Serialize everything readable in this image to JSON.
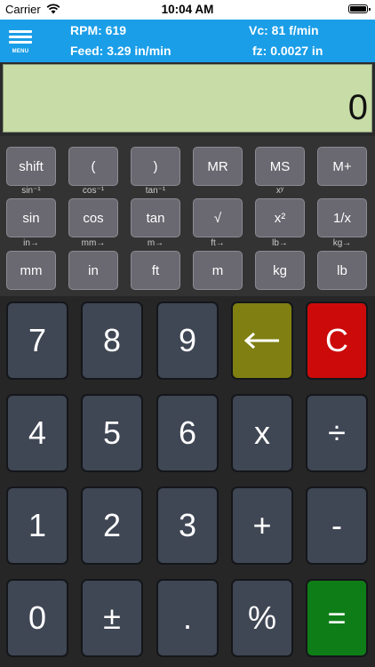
{
  "status_bar": {
    "carrier": "Carrier",
    "time": "10:04 AM"
  },
  "header": {
    "menu_label": "MENU",
    "rpm": "RPM: 619",
    "vc": "Vc: 81 f/min",
    "feed": "Feed: 3.29 in/min",
    "fz": "fz: 0.0027 in"
  },
  "display": {
    "value": "0"
  },
  "function_rows": [
    [
      "shift",
      "(",
      ")",
      "MR",
      "MS",
      "M+"
    ],
    [
      "sin",
      "cos",
      "tan",
      "√",
      "x²",
      "1/x"
    ],
    [
      "mm",
      "in",
      "ft",
      "m",
      "kg",
      "lb"
    ]
  ],
  "sublabels_row1": [
    "sin⁻¹",
    "cos⁻¹",
    "tan⁻¹",
    "",
    "xʸ",
    ""
  ],
  "sublabels_row2": [
    "in→",
    "mm→",
    "m→",
    "ft→",
    "lb→",
    "kg→"
  ],
  "keypad": [
    [
      "7",
      "8",
      "9",
      "←",
      "C"
    ],
    [
      "4",
      "5",
      "6",
      "x",
      "÷"
    ],
    [
      "1",
      "2",
      "3",
      "+",
      "-"
    ],
    [
      "0",
      "±",
      ".",
      "%",
      "="
    ]
  ],
  "colors": {
    "header": "#1a9ee8",
    "display": "#c7dca6",
    "backspace": "#7f7f12",
    "clear": "#cc0a0a",
    "equals": "#0f7d17"
  }
}
